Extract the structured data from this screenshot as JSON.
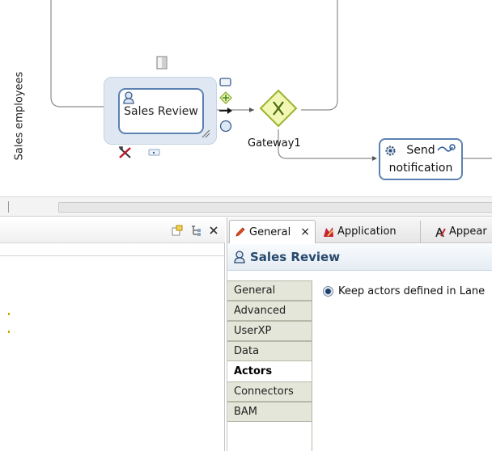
{
  "diagram": {
    "lane_label": "Sales employees",
    "task_label": "Sales Review",
    "gateway_label": "Gateway1",
    "send_task": {
      "line1": "Send",
      "line2": "notification"
    }
  },
  "properties": {
    "tabs": [
      {
        "label": "General",
        "active": true,
        "icon": "pencil-icon"
      },
      {
        "label": "Application",
        "active": false,
        "icon": "application-icon"
      },
      {
        "label": "Appear",
        "active": false,
        "icon": "appearance-icon"
      }
    ],
    "close_label": "×",
    "title": "Sales Review",
    "side_tabs": [
      "General",
      "Advanced",
      "UserXP",
      "Data",
      "Actors",
      "Connectors",
      "BAM"
    ],
    "active_side_tab": "Actors",
    "option_label": "Keep actors defined in Lane"
  },
  "colors": {
    "task_border": "#5b82b1",
    "gateway_fill": "#f2f7b4",
    "gateway_border": "#9cb32e",
    "title_text": "#27496d"
  }
}
